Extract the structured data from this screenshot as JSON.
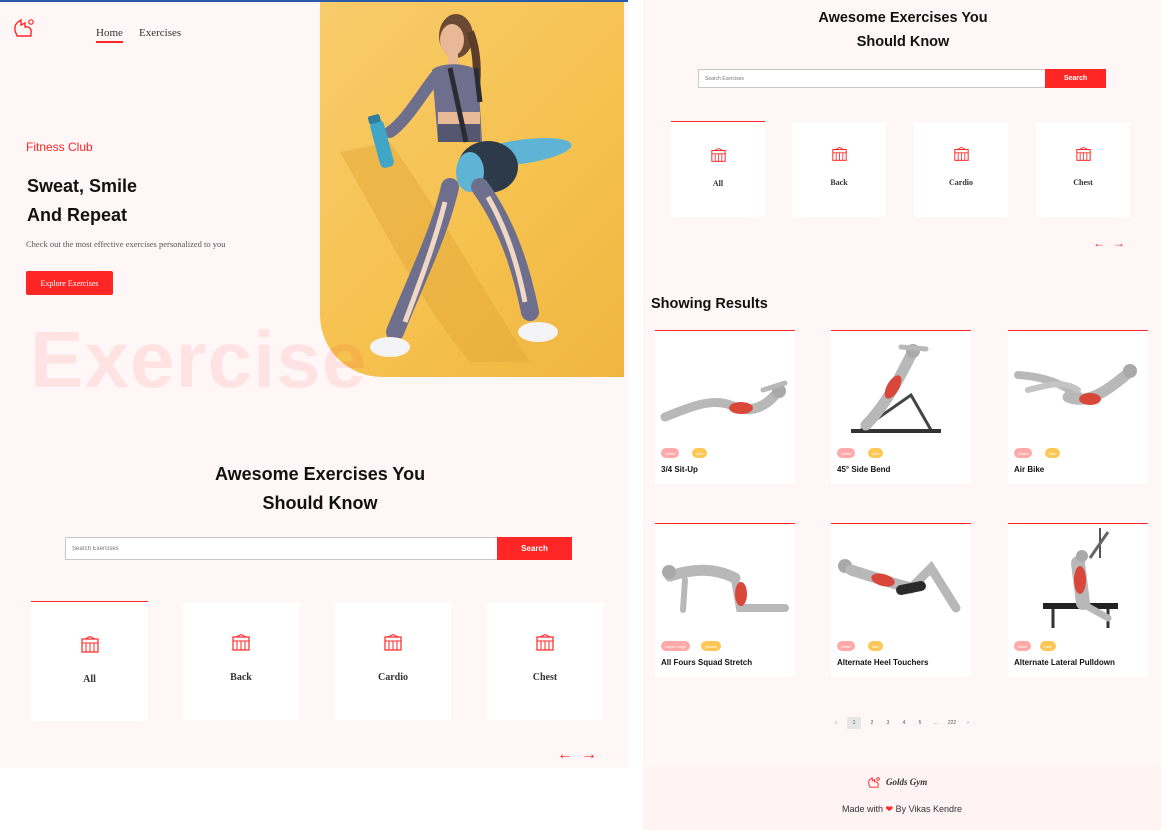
{
  "nav": {
    "home": "Home",
    "exercises": "Exercises"
  },
  "hero": {
    "tagline": "Fitness Club",
    "title_line1": "Sweat, Smile",
    "title_line2": "And Repeat",
    "subtitle": "Check out the most effective exercises personalized to you",
    "cta": "Explore Exercises",
    "bg_word": "Exercise"
  },
  "section": {
    "title_line1": "Awesome Exercises You",
    "title_line2": "Should Know"
  },
  "search": {
    "placeholder": "Search Exercises",
    "button": "Search"
  },
  "categories": [
    "All",
    "Back",
    "Cardio",
    "Chest"
  ],
  "category_icon": "gym-icon",
  "arrows": {
    "left": "←",
    "right": "→"
  },
  "results": {
    "title": "Showing Results",
    "items": [
      {
        "name": "3/4 Sit-Up",
        "body_part": "Waist",
        "target": "Abs"
      },
      {
        "name": "45° Side Bend",
        "body_part": "Waist",
        "target": "Abs"
      },
      {
        "name": "Air Bike",
        "body_part": "Waist",
        "target": "Abs"
      },
      {
        "name": "All Fours Squad Stretch",
        "body_part": "Upper Legs",
        "target": "Quads"
      },
      {
        "name": "Alternate Heel Touchers",
        "body_part": "Waist",
        "target": "Abs"
      },
      {
        "name": "Alternate Lateral Pulldown",
        "body_part": "Back",
        "target": "Lats"
      }
    ]
  },
  "pagination": {
    "prev": "‹",
    "pages": [
      "1",
      "2",
      "3",
      "4",
      "5",
      "...",
      "222"
    ],
    "next": "›",
    "current": "1"
  },
  "footer": {
    "brand": "Golds Gym",
    "made_with": "Made with",
    "heart": "❤",
    "author": "By Vikas Kendre"
  },
  "colors": {
    "accent": "#ff2625",
    "tag_pink": "#ffa9a9",
    "tag_yellow": "#fcc757",
    "background": "#fff7f7",
    "hero_bg": "#f6c250"
  }
}
